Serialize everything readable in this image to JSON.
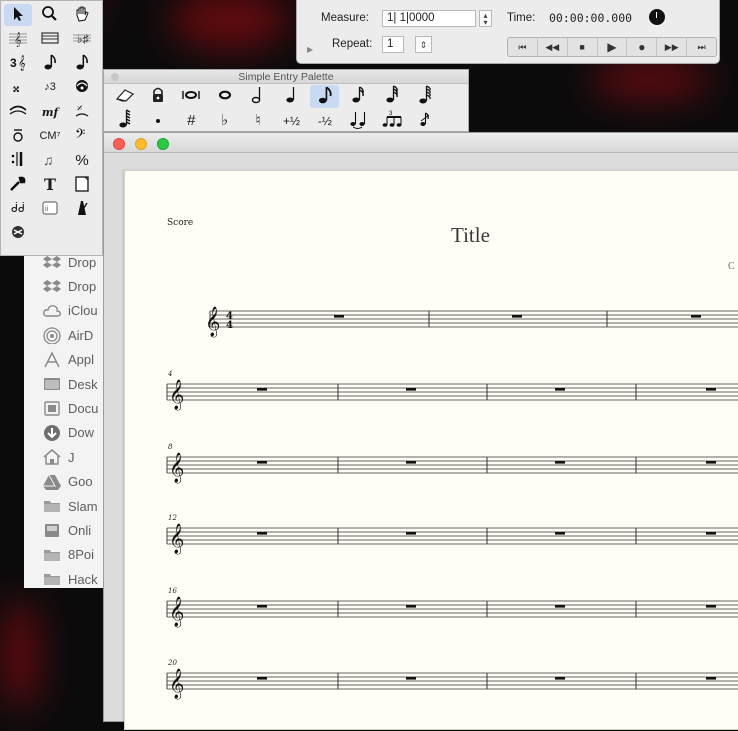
{
  "colors": {
    "desktop": "#0c0b0c",
    "desktop_glow": "#7e0b10",
    "selection": "#c9d9f2",
    "page": "#fffdf5"
  },
  "tool_palette": {
    "tools": [
      {
        "name": "selection-tool",
        "icon": "arrow-icon",
        "selected": true
      },
      {
        "name": "zoom-tool",
        "icon": "magnifier-icon"
      },
      {
        "name": "hand-grabber-tool",
        "icon": "hand-icon"
      },
      {
        "name": "staff-tool",
        "icon": "treble-staff-icon"
      },
      {
        "name": "measure-tool",
        "icon": "measure-icon"
      },
      {
        "name": "key-signature-tool",
        "icon": "key-signature-icon"
      },
      {
        "name": "time-signature-tool",
        "icon": "time-signature-icon"
      },
      {
        "name": "simple-entry-tool",
        "icon": "eighth-note-icon"
      },
      {
        "name": "speedy-entry-tool",
        "icon": "eighth-note-icon"
      },
      {
        "name": "clef-tool",
        "icon": "clef-icon"
      },
      {
        "name": "tuplet-tool",
        "label": "♪3",
        "icon": "tuplet-icon"
      },
      {
        "name": "articulation-tool",
        "icon": "articulation-icon"
      },
      {
        "name": "smart-shape-tool",
        "icon": "slur-icon"
      },
      {
        "name": "expression-tool",
        "label": "mf",
        "icon": "expression-icon"
      },
      {
        "name": "repeat-tool",
        "icon": "repeat-icon"
      },
      {
        "name": "lyrics-tool",
        "icon": "lyrics-icon"
      },
      {
        "name": "chord-tool",
        "label": "CM⁷",
        "icon": "chord-icon"
      },
      {
        "name": "mirror-tool",
        "icon": "bass-clef-icon"
      },
      {
        "name": "mirror-barline-tool",
        "icon": "repeat-barline-icon"
      },
      {
        "name": "graphics-tool",
        "icon": "notes-icon"
      },
      {
        "name": "percent-tool",
        "label": "%",
        "icon": "percent-icon"
      },
      {
        "name": "utilities-tool",
        "icon": "wrench-icon"
      },
      {
        "name": "text-tool",
        "label": "T",
        "icon": "text-icon"
      },
      {
        "name": "page-layout-tool",
        "icon": "page-icon"
      },
      {
        "name": "lyric-verse-tool",
        "label": "ᑰᑰ",
        "icon": "notes-stack-icon"
      },
      {
        "name": "midi-tool",
        "icon": "midi-icon"
      },
      {
        "name": "tempo-tool",
        "icon": "metronome-icon"
      },
      {
        "name": "special-tools",
        "icon": "special-icon"
      }
    ]
  },
  "playback": {
    "measure_label": "Measure:",
    "measure_value": "1| 1|0000",
    "time_label": "Time:",
    "time_value": "00:00:00.000",
    "repeat_label": "Repeat:",
    "repeat_value": "1",
    "transport": [
      {
        "icon": "rewind-start-icon",
        "glyph": "⏮"
      },
      {
        "icon": "rewind-icon",
        "glyph": "◀◀"
      },
      {
        "icon": "stop-icon",
        "glyph": "■"
      },
      {
        "icon": "play-icon",
        "glyph": "▶"
      },
      {
        "icon": "record-icon",
        "glyph": "●"
      },
      {
        "icon": "fast-forward-icon",
        "glyph": "▶▶"
      },
      {
        "icon": "forward-end-icon",
        "glyph": "⏭"
      }
    ]
  },
  "simple_entry_palette": {
    "title": "Simple Entry Palette",
    "row1": [
      {
        "name": "eraser-button",
        "icon": "eraser-icon"
      },
      {
        "name": "lock-button",
        "icon": "lock-icon"
      },
      {
        "name": "double-whole-note-button",
        "icon": "double-whole-note-icon"
      },
      {
        "name": "whole-note-button",
        "icon": "whole-note-icon"
      },
      {
        "name": "half-note-button",
        "icon": "half-note-icon"
      },
      {
        "name": "quarter-note-button",
        "icon": "quarter-note-icon"
      },
      {
        "name": "eighth-note-button",
        "icon": "eighth-note-icon",
        "selected": true
      },
      {
        "name": "sixteenth-note-button",
        "icon": "sixteenth-note-icon"
      },
      {
        "name": "thirty-second-note-button",
        "icon": "thirty-second-note-icon"
      },
      {
        "name": "sixty-fourth-note-button",
        "icon": "sixty-fourth-note-icon"
      }
    ],
    "row2": [
      {
        "name": "128th-note-button",
        "icon": "128th-note-icon"
      },
      {
        "name": "dot-button",
        "icon": "dot-icon"
      },
      {
        "name": "sharp-button",
        "label": "#",
        "icon": "sharp-icon"
      },
      {
        "name": "flat-button",
        "label": "♭",
        "icon": "flat-icon"
      },
      {
        "name": "natural-button",
        "label": "♮",
        "icon": "natural-icon"
      },
      {
        "name": "raise-half-step-button",
        "label": "+½",
        "icon": "raise-icon"
      },
      {
        "name": "lower-half-step-button",
        "label": "-½",
        "icon": "lower-icon"
      },
      {
        "name": "tie-button",
        "icon": "tie-icon"
      },
      {
        "name": "tuplet-button",
        "icon": "tuplet-icon"
      },
      {
        "name": "grace-note-button",
        "icon": "grace-note-icon"
      }
    ]
  },
  "finder_sidebar": {
    "items": [
      {
        "label": "Drop",
        "icon": "dropbox-icon"
      },
      {
        "label": "Drop",
        "icon": "dropbox-icon"
      },
      {
        "label": "iClou",
        "icon": "icloud-icon"
      },
      {
        "label": "AirD",
        "icon": "airdrop-icon"
      },
      {
        "label": "Appl",
        "icon": "applications-icon"
      },
      {
        "label": "Desk",
        "icon": "desktop-icon"
      },
      {
        "label": "Docu",
        "icon": "documents-icon"
      },
      {
        "label": "Dow",
        "icon": "downloads-icon"
      },
      {
        "label": "J",
        "icon": "home-icon"
      },
      {
        "label": "Goo",
        "icon": "google-drive-icon"
      },
      {
        "label": "Slam",
        "icon": "folder-icon"
      },
      {
        "label": "Onli",
        "icon": "disk-icon"
      },
      {
        "label": "8Poi",
        "icon": "folder-icon"
      },
      {
        "label": "Hack",
        "icon": "folder-icon"
      }
    ]
  },
  "score": {
    "label": "Score",
    "title": "Title",
    "composer": "C",
    "time_signature": {
      "top": "4",
      "bottom": "4"
    },
    "system_numbers": [
      "4",
      "8",
      "12",
      "16",
      "20"
    ]
  }
}
